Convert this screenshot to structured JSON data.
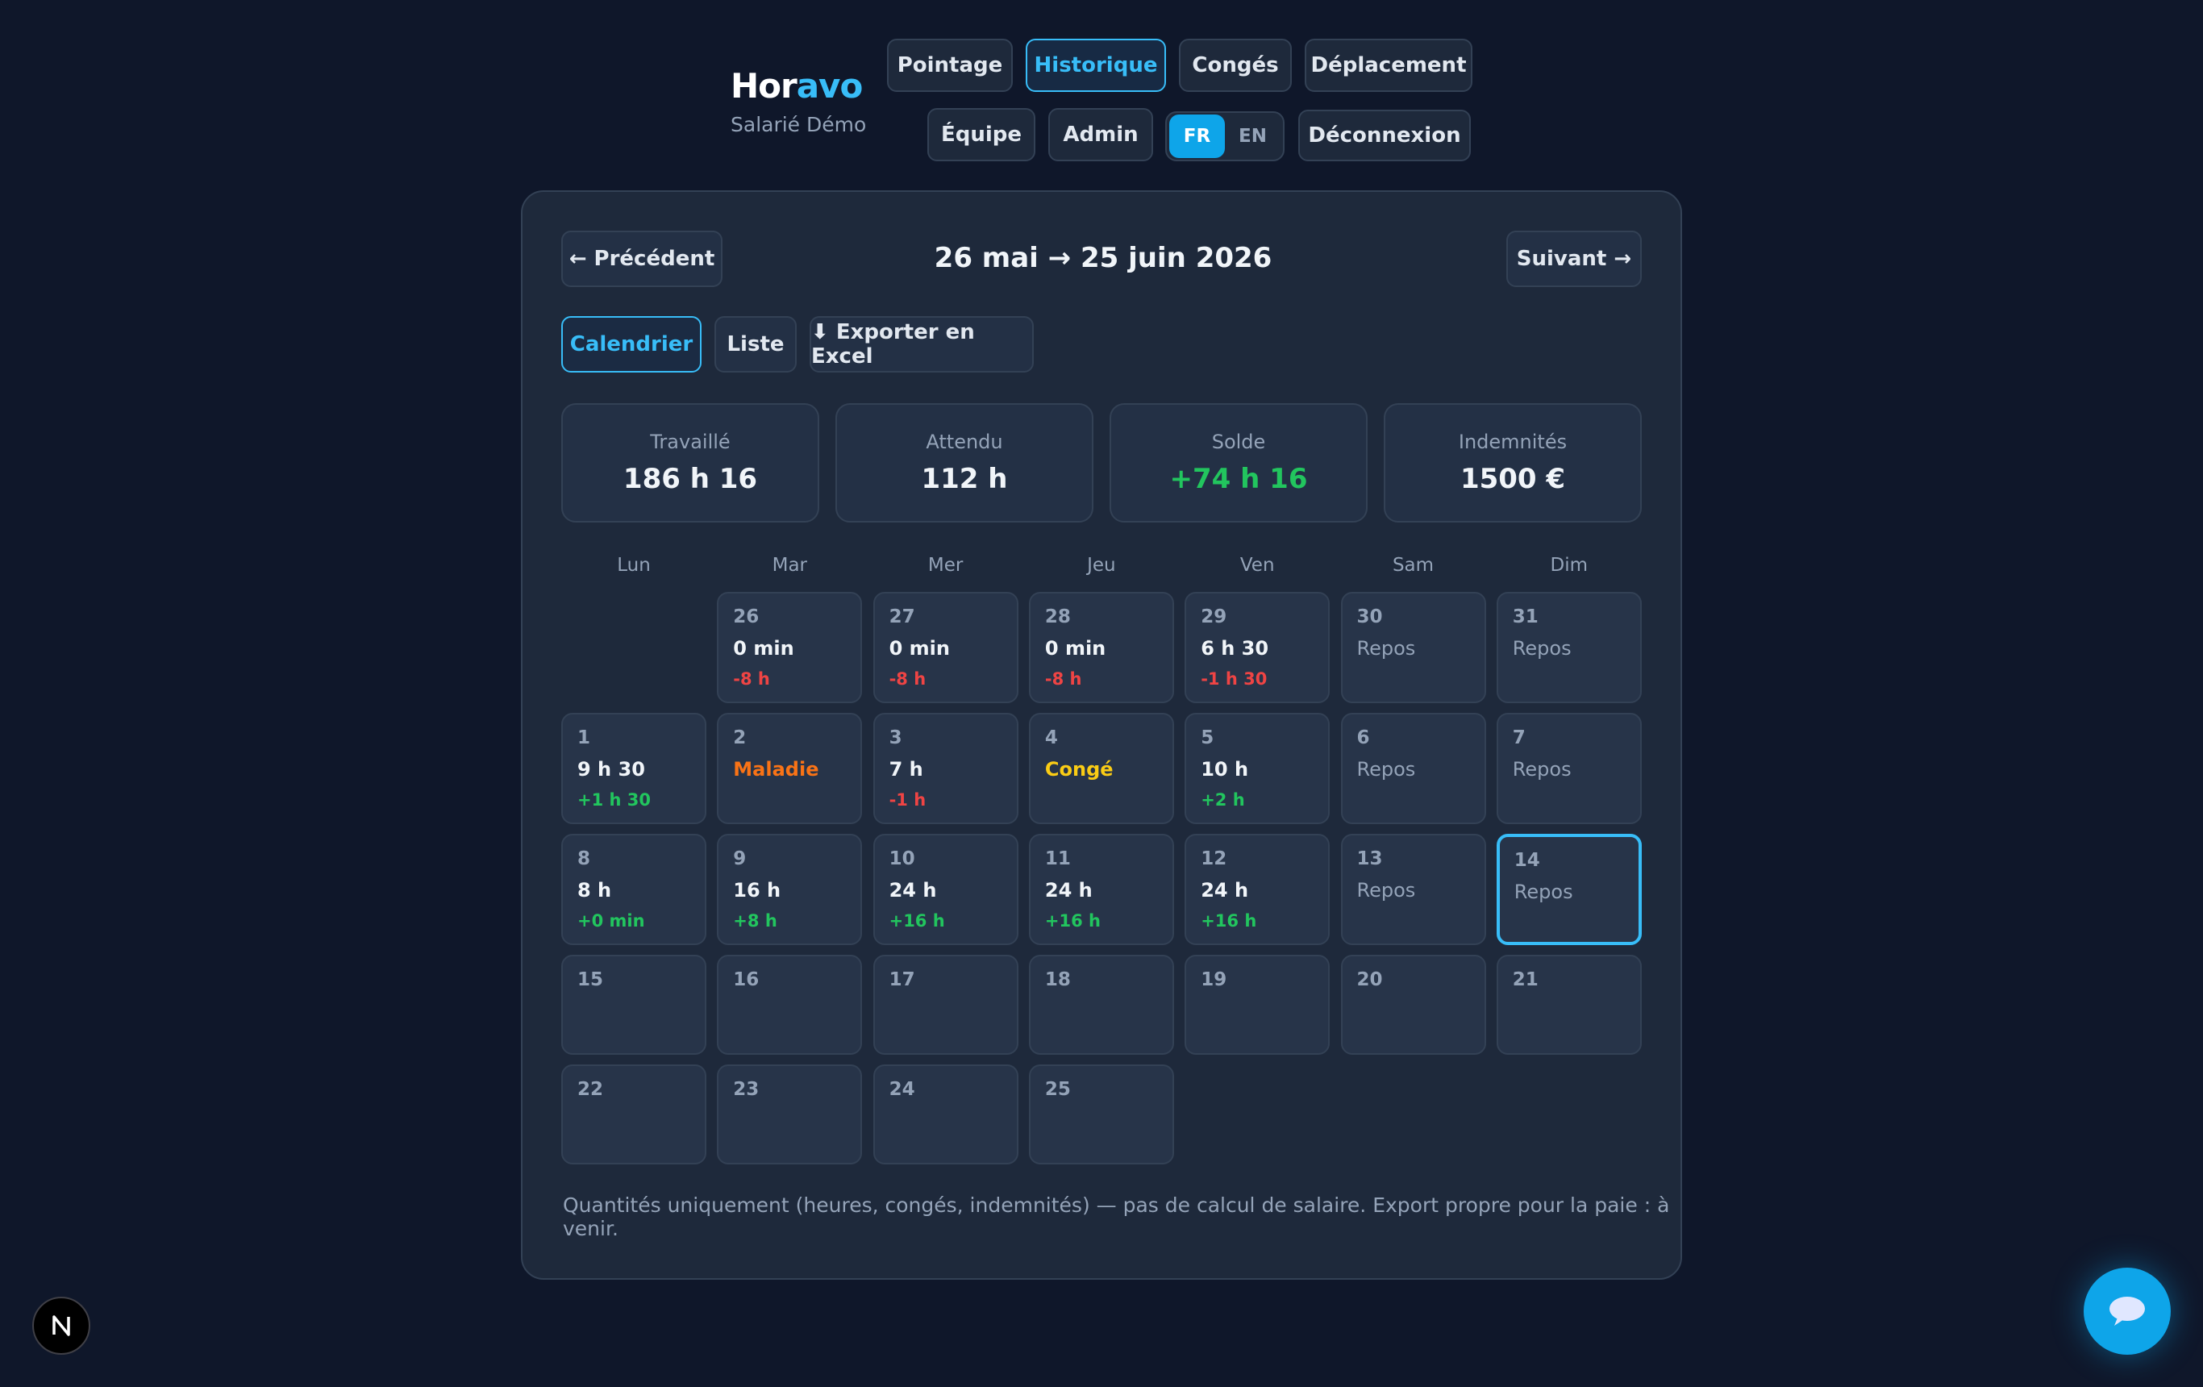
{
  "brand": {
    "name_a": "Hor",
    "name_b": "avo",
    "user": "Salarié Démo"
  },
  "nav": {
    "pointage": "Pointage",
    "historique": "Historique",
    "conges": "Congés",
    "deplacement": "Déplacement",
    "equipe": "Équipe",
    "admin": "Admin",
    "lang_fr": "FR",
    "lang_en": "EN",
    "logout": "Déconnexion"
  },
  "period": {
    "prev": "← Précédent",
    "label": "26 mai → 25 juin 2026",
    "next": "Suivant →"
  },
  "views": {
    "calendar": "Calendrier",
    "list": "Liste",
    "export": "⬇ Exporter en Excel"
  },
  "stats": [
    {
      "label": "Travaillé",
      "value": "186 h 16"
    },
    {
      "label": "Attendu",
      "value": "112 h"
    },
    {
      "label": "Solde",
      "value": "+74 h 16"
    },
    {
      "label": "Indemnités",
      "value": "1500 €"
    }
  ],
  "weekdays": [
    "Lun",
    "Mar",
    "Mer",
    "Jeu",
    "Ven",
    "Sam",
    "Dim"
  ],
  "days": [
    {
      "day": "26",
      "main": "0 min",
      "diff": "-8 h"
    },
    {
      "day": "27",
      "main": "0 min",
      "diff": "-8 h"
    },
    {
      "day": "28",
      "main": "0 min",
      "diff": "-8 h"
    },
    {
      "day": "29",
      "main": "6 h 30",
      "diff": "-1 h 30"
    },
    {
      "day": "30",
      "main": "Repos",
      "diff": ""
    },
    {
      "day": "31",
      "main": "Repos",
      "diff": ""
    },
    {
      "day": "1",
      "main": "9 h 30",
      "diff": "+1 h 30"
    },
    {
      "day": "2",
      "main": "Maladie",
      "diff": ""
    },
    {
      "day": "3",
      "main": "7 h",
      "diff": "-1 h"
    },
    {
      "day": "4",
      "main": "Congé",
      "diff": ""
    },
    {
      "day": "5",
      "main": "10 h",
      "diff": "+2 h"
    },
    {
      "day": "6",
      "main": "Repos",
      "diff": ""
    },
    {
      "day": "7",
      "main": "Repos",
      "diff": ""
    },
    {
      "day": "8",
      "main": "8 h",
      "diff": "+0 min"
    },
    {
      "day": "9",
      "main": "16 h",
      "diff": "+8 h"
    },
    {
      "day": "10",
      "main": "24 h",
      "diff": "+16 h"
    },
    {
      "day": "11",
      "main": "24 h",
      "diff": "+16 h"
    },
    {
      "day": "12",
      "main": "24 h",
      "diff": "+16 h"
    },
    {
      "day": "13",
      "main": "Repos",
      "diff": ""
    },
    {
      "day": "14",
      "main": "Repos",
      "diff": ""
    },
    {
      "day": "15",
      "main": "",
      "diff": ""
    },
    {
      "day": "16",
      "main": "",
      "diff": ""
    },
    {
      "day": "17",
      "main": "",
      "diff": ""
    },
    {
      "day": "18",
      "main": "",
      "diff": ""
    },
    {
      "day": "19",
      "main": "",
      "diff": ""
    },
    {
      "day": "20",
      "main": "",
      "diff": ""
    },
    {
      "day": "21",
      "main": "",
      "diff": ""
    },
    {
      "day": "22",
      "main": "",
      "diff": ""
    },
    {
      "day": "23",
      "main": "",
      "diff": ""
    },
    {
      "day": "24",
      "main": "",
      "diff": ""
    },
    {
      "day": "25",
      "main": "",
      "diff": ""
    }
  ],
  "today": "14",
  "footer_note": "Quantités uniquement (heures, congés, indemnités) — pas de calcul de salaire. Export propre pour la paie : à venir.",
  "colors": {
    "background": "#0f172a",
    "accent": "#38bdf8",
    "positive": "#22c55e",
    "negative": "#ef4444",
    "sick": "#f97316",
    "leave": "#facc15"
  },
  "icons": {
    "corner_badge": "n-logo-icon",
    "chat": "chat-bubble-icon"
  }
}
